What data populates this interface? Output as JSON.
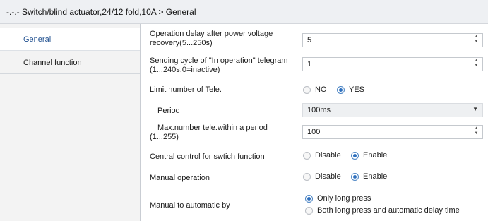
{
  "window": {
    "title": "-.-.- Switch/blind actuator,24/12 fold,10A > General"
  },
  "sidebar": {
    "items": [
      {
        "label": "General",
        "active": true
      },
      {
        "label": "Channel function",
        "active": false
      }
    ]
  },
  "params": {
    "power_delay": {
      "label_line1": "Operation delay after power voltage",
      "label_line2": "recovery(5...250s)",
      "value": "5"
    },
    "sending_cycle": {
      "label_line1": "Sending cycle of \"In operation\" telegram",
      "label_line2": "(1...240s,0=inactive)",
      "value": "1"
    },
    "limit_tele": {
      "label": "Limit number of Tele.",
      "options": [
        "NO",
        "YES"
      ],
      "selected": "YES"
    },
    "period": {
      "label": "Period",
      "value": "100ms"
    },
    "max_number": {
      "label_line1": "Max.number tele.within a period",
      "label_line2": "(1...255)",
      "value": "100"
    },
    "central_control": {
      "label": "Central control for swtich function",
      "options": [
        "Disable",
        "Enable"
      ],
      "selected": "Enable"
    },
    "manual_operation": {
      "label": "Manual operation",
      "options": [
        "Disable",
        "Enable"
      ],
      "selected": "Enable"
    },
    "manual_to_auto": {
      "label": "Manual to automatic by",
      "options": [
        "Only long press",
        "Both long press and automatic delay time"
      ],
      "selected": "Only long press"
    }
  },
  "icons": {
    "spinner": "spinner-arrows-icon",
    "dropdown": "chevron-down-icon",
    "radio": "radio-button-icon"
  },
  "colors": {
    "accent": "#2e6fbd",
    "sidebar_bg": "#f3f3f3",
    "title_bg": "#eef0f3"
  }
}
